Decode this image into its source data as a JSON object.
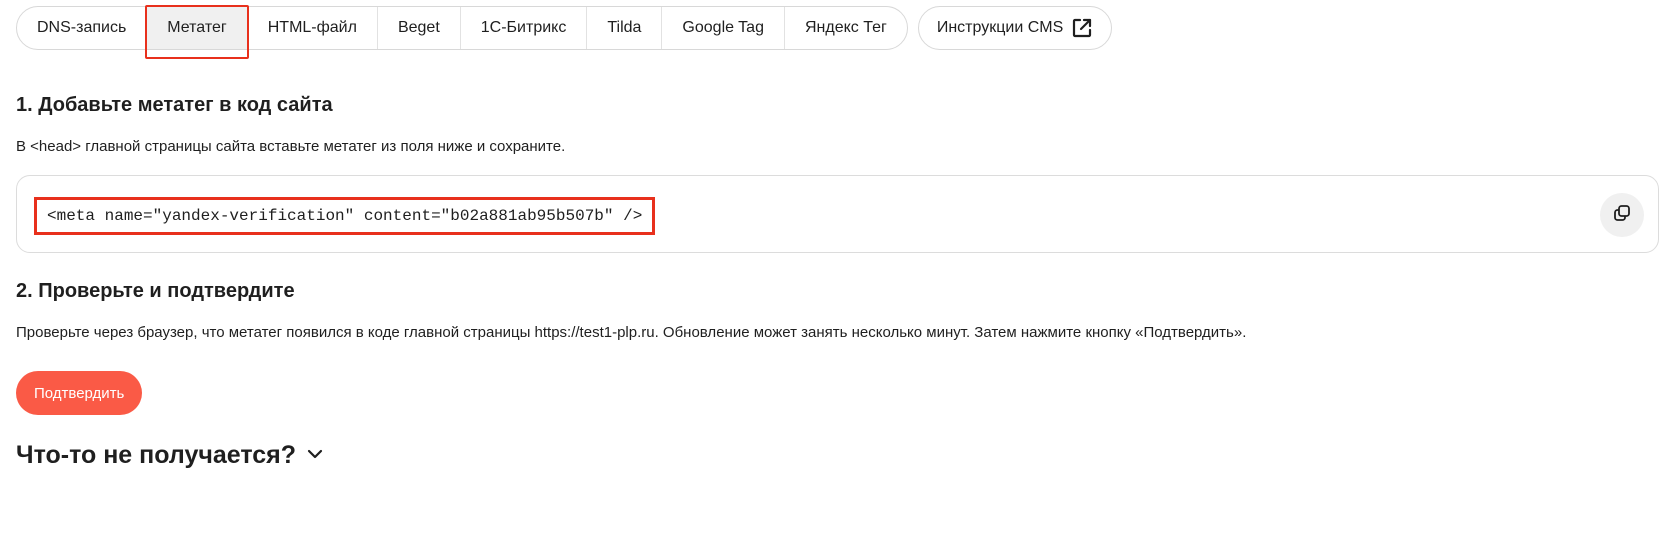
{
  "tabs": [
    {
      "label": "DNS-запись",
      "active": false
    },
    {
      "label": "Метатег",
      "active": true
    },
    {
      "label": "HTML-файл",
      "active": false
    },
    {
      "label": "Beget",
      "active": false
    },
    {
      "label": "1С-Битрикс",
      "active": false
    },
    {
      "label": "Tilda",
      "active": false
    },
    {
      "label": "Google Tag",
      "active": false
    },
    {
      "label": "Яндекс Тег",
      "active": false
    }
  ],
  "cms_tab": {
    "label": "Инструкции CMS",
    "icon": "external-link-icon"
  },
  "step1": {
    "title": "1. Добавьте метатег в код сайта",
    "description": "В <head> главной страницы сайта вставьте метатег из поля ниже и сохраните.",
    "code": "<meta name=\"yandex-verification\" content=\"b02a881ab95b507b\" />",
    "copy_icon": "copy-icon"
  },
  "step2": {
    "title": "2. Проверьте и подтвердите",
    "description": "Проверьте через браузер, что метатег появился в коде главной страницы https://test1-plp.ru. Обновление может занять несколько минут. Затем нажмите кнопку «Подтвердить»."
  },
  "confirm_button": {
    "label": "Подтвердить"
  },
  "trouble": {
    "title": "Что-то не получается?",
    "icon": "chevron-down-icon"
  },
  "colors": {
    "accent": "#fa5a46",
    "highlight": "#e8301c",
    "active_tab_bg": "#f0f0f0"
  }
}
